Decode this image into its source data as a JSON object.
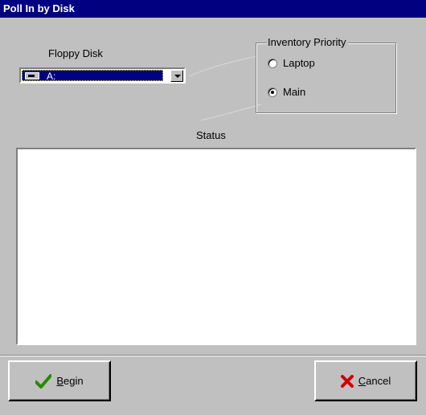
{
  "window": {
    "title": "Poll In by Disk"
  },
  "floppy": {
    "label": "Floppy Disk",
    "selected": "A:",
    "icon": "floppy-drive-icon"
  },
  "priority": {
    "legend": "Inventory Priority",
    "options": [
      {
        "label": "Laptop",
        "checked": false
      },
      {
        "label": "Main",
        "checked": true
      }
    ]
  },
  "status": {
    "label": "Status",
    "text": ""
  },
  "buttons": {
    "begin": {
      "prefix": "",
      "accel": "B",
      "rest": "egin",
      "icon": "checkmark-icon",
      "icon_color": "#2a8a00"
    },
    "cancel": {
      "prefix": "",
      "accel": "C",
      "rest": "ancel",
      "icon": "x-icon",
      "icon_color": "#d00000"
    }
  }
}
